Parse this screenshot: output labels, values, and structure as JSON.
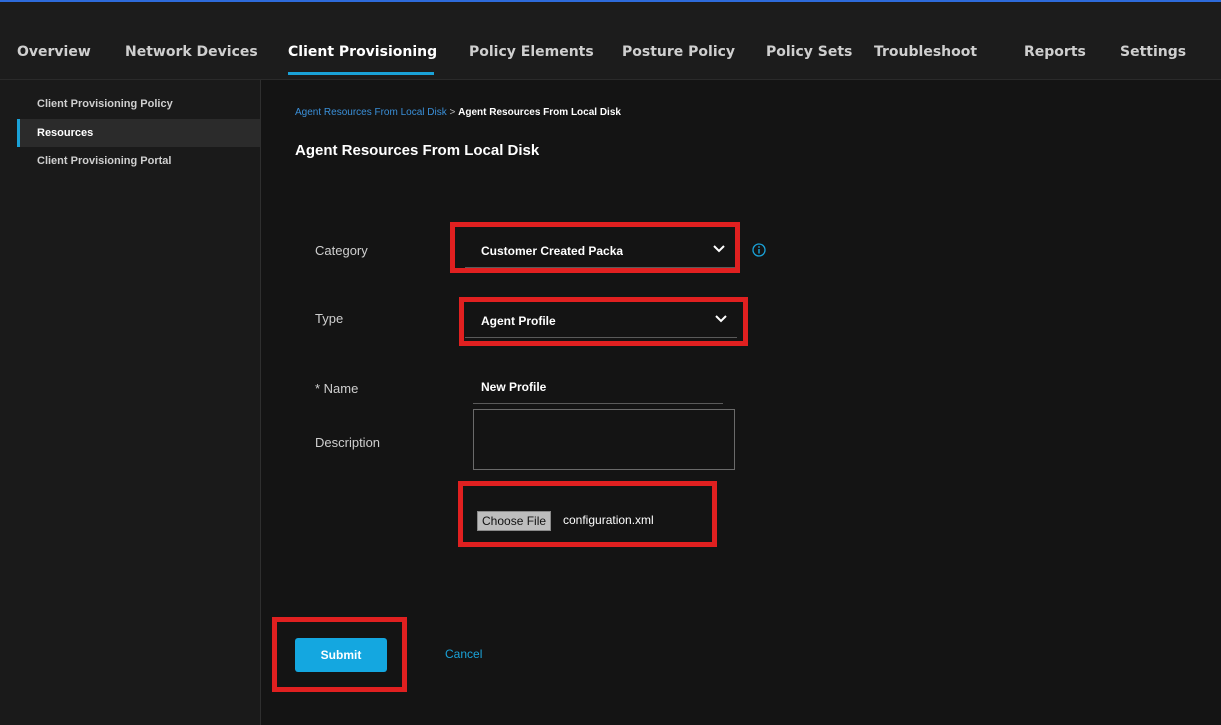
{
  "nav": {
    "items": [
      {
        "label": "Overview"
      },
      {
        "label": "Network Devices"
      },
      {
        "label": "Client Provisioning"
      },
      {
        "label": "Policy Elements"
      },
      {
        "label": "Posture Policy"
      },
      {
        "label": "Policy Sets"
      },
      {
        "label": "Troubleshoot"
      },
      {
        "label": "Reports"
      },
      {
        "label": "Settings"
      }
    ],
    "active": "Client Provisioning"
  },
  "sidebar": {
    "items": [
      {
        "label": "Client Provisioning Policy"
      },
      {
        "label": "Resources"
      },
      {
        "label": "Client Provisioning Portal"
      }
    ],
    "active": "Resources"
  },
  "breadcrumb": {
    "link": "Agent Resources From Local Disk",
    "separator": ">",
    "current": "Agent Resources From Local Disk"
  },
  "page": {
    "title": "Agent Resources From Local Disk"
  },
  "form": {
    "category": {
      "label": "Category",
      "value": "Customer Created Packa"
    },
    "type": {
      "label": "Type",
      "value": "Agent Profile"
    },
    "name": {
      "label": "* Name",
      "value": "New Profile"
    },
    "description": {
      "label": "Description",
      "value": ""
    },
    "file": {
      "button_label": "Choose File",
      "file_name": "configuration.xml"
    }
  },
  "actions": {
    "submit_label": "Submit",
    "cancel_label": "Cancel"
  },
  "colors": {
    "accent": "#1aa2d8",
    "highlight": "#e02020",
    "background": "#141414"
  },
  "icons": {
    "info": "info-icon",
    "dropdown": "chevron-down-icon"
  }
}
